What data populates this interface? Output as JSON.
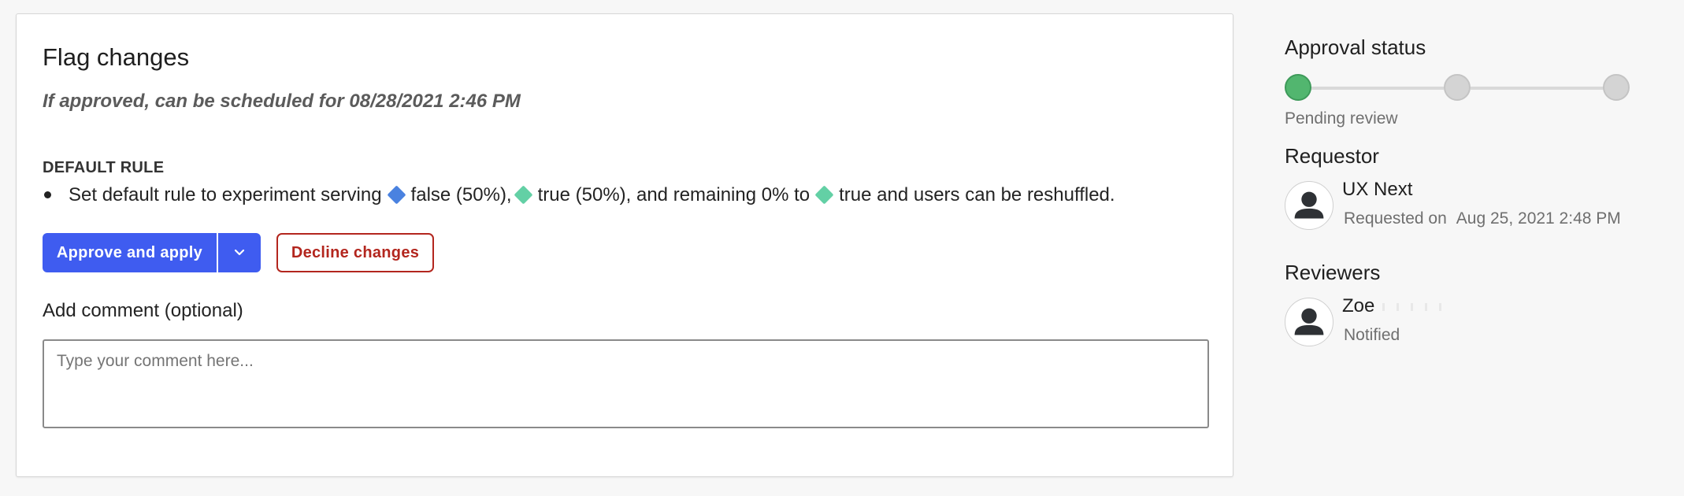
{
  "flag_changes": {
    "title": "Flag changes",
    "schedule_note": "If approved, can be scheduled for 08/28/2021 2:46 PM",
    "default_rule_label": "DEFAULT RULE",
    "rule": {
      "prefix": "Set default rule to experiment serving",
      "variation_1": "false (50%),",
      "variation_2": "true (50%), and remaining 0% to",
      "variation_3": "true and users can be reshuffled.",
      "variation_1_color": "#4a82e0",
      "variation_2_color": "#63d0a5",
      "variation_3_color": "#63d0a5"
    },
    "approve_label": "Approve and apply",
    "approve_menu_icon": "chevron-down-icon",
    "decline_label": "Decline changes",
    "comment_label": "Add comment (optional)",
    "comment_placeholder": "Type your comment here...",
    "comment_value": ""
  },
  "approval_status": {
    "heading": "Approval status",
    "steps": [
      "complete",
      "pending",
      "pending"
    ],
    "caption": "Pending review",
    "complete_color": "#52b66f",
    "pending_color": "#d4d4d4"
  },
  "requestor": {
    "heading": "Requestor",
    "name": "UX Next",
    "requested_label": "Requested on",
    "requested_at": "Aug 25, 2021 2:48 PM",
    "avatar_icon": "user-avatar-icon"
  },
  "reviewers": {
    "heading": "Reviewers",
    "items": [
      {
        "name": "Zoe",
        "status": "Notified",
        "avatar_icon": "user-avatar-icon"
      }
    ]
  },
  "colors": {
    "primary": "#3f5cf0",
    "danger": "#b3261e",
    "success": "#52b66f"
  }
}
